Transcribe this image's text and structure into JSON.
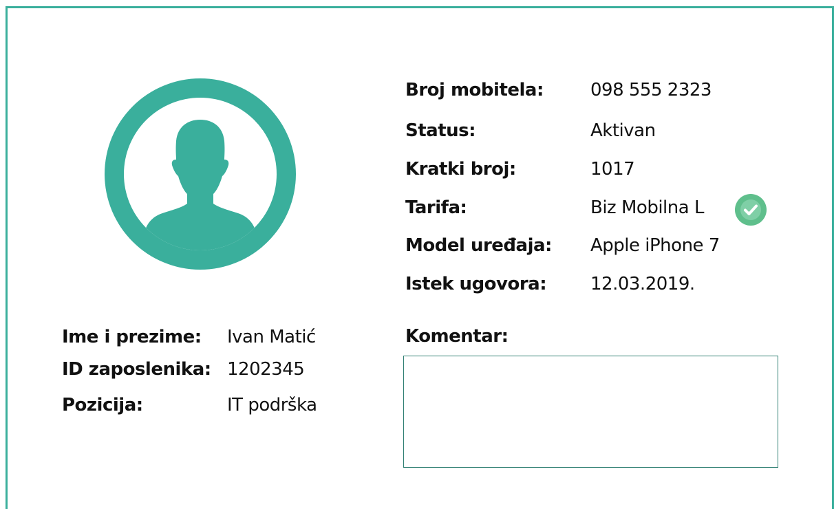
{
  "colors": {
    "accent": "#3aaf9c",
    "check": "#5fbf8c",
    "text": "#111111"
  },
  "avatar": {
    "icon": "user-silhouette-icon"
  },
  "employee": {
    "name_label": "Ime i prezime:",
    "name_value": "Ivan Matić",
    "id_label": "ID zaposlenika:",
    "id_value": "1202345",
    "position_label": "Pozicija:",
    "position_value": "IT podrška"
  },
  "details": {
    "mobile_label": "Broj mobitela:",
    "mobile_value": "098 555 2323",
    "status_label": "Status:",
    "status_value": "Aktivan",
    "short_label": "Kratki broj:",
    "short_value": "1017",
    "tariff_label": "Tarifa:",
    "tariff_value": "Biz Mobilna L",
    "tariff_icon": "check-circle-icon",
    "device_label": "Model uređaja:",
    "device_value": "Apple iPhone 7",
    "expiry_label": "Istek ugovora:",
    "expiry_value": "12.03.2019."
  },
  "comment": {
    "label": "Komentar:",
    "value": ""
  }
}
